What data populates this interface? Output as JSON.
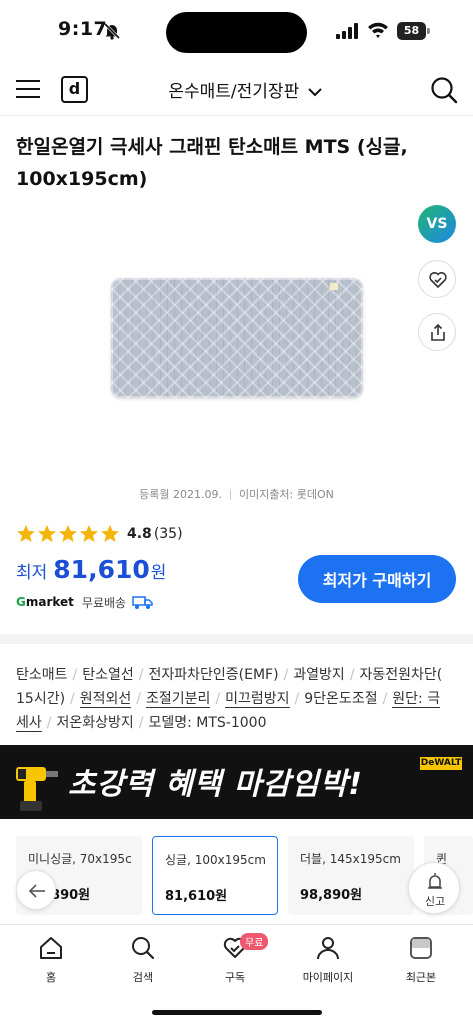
{
  "status_bar": {
    "time": "9:17",
    "battery": "58"
  },
  "nav": {
    "logo": "d",
    "category": "온수매트/전기장판"
  },
  "product": {
    "title": "한일온열기 극세사 그래핀 탄소매트 MTS (싱글, 100x195cm)",
    "side_badge": "VS",
    "image_meta": {
      "registered": "등록월 2021.09.",
      "source": "이미지출처: 롯데ON"
    },
    "rating": {
      "score": "4.8",
      "count": "(35)",
      "stars": 5
    },
    "price": {
      "label": "최저",
      "value": "81,610",
      "unit": "원"
    },
    "shop": {
      "logo_g": "G",
      "logo_rest": "market",
      "shipping": "무료배송"
    },
    "cta": "최저가 구매하기"
  },
  "specs": {
    "line1": [
      "탄소매트",
      "탄소열선",
      "전자파차단인증(EMF)",
      "과열방지",
      "자동전원차단("
    ],
    "line2": [
      "15시간)",
      "원적외선",
      "조절기분리",
      "미끄럼방지",
      "9단온도조절",
      "원단: 극"
    ],
    "line3": [
      "세사",
      "저온화상방지",
      "모델명: MTS-1000"
    ]
  },
  "banner": {
    "text": "초강력 혜택 마감임박!",
    "brand": "DeWALT"
  },
  "options": [
    {
      "name": "미니싱글, 70x195c",
      "price": "79,890원"
    },
    {
      "name": "싱글, 100x195cm",
      "price": "81,610원"
    },
    {
      "name": "더블, 145x195cm",
      "price": "98,890원"
    },
    {
      "name": "퀸",
      "price": ""
    }
  ],
  "report_label": "신고",
  "tabs": [
    {
      "label": "홈",
      "icon": "home-icon"
    },
    {
      "label": "검색",
      "icon": "search-icon"
    },
    {
      "label": "구독",
      "icon": "heart-check-icon",
      "badge": "무료"
    },
    {
      "label": "마이페이지",
      "icon": "person-icon"
    },
    {
      "label": "최근본",
      "icon": "recent-icon"
    }
  ],
  "colors": {
    "accent": "#1d72f2",
    "star": "#f5b50a",
    "price": "#1a4fd6",
    "badge": "#f0566e"
  }
}
